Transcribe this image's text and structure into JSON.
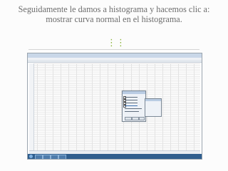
{
  "slide": {
    "title": "Seguidamente le damos a histograma y hacemos clic a: mostrar curva normal en el histograma.",
    "accent_color": "#8bb33a",
    "decoration_icon": "three-links-icon"
  },
  "screenshot": {
    "window_title": "",
    "menu_items": [],
    "tabs": [],
    "dialog_title": "",
    "clock": ""
  }
}
